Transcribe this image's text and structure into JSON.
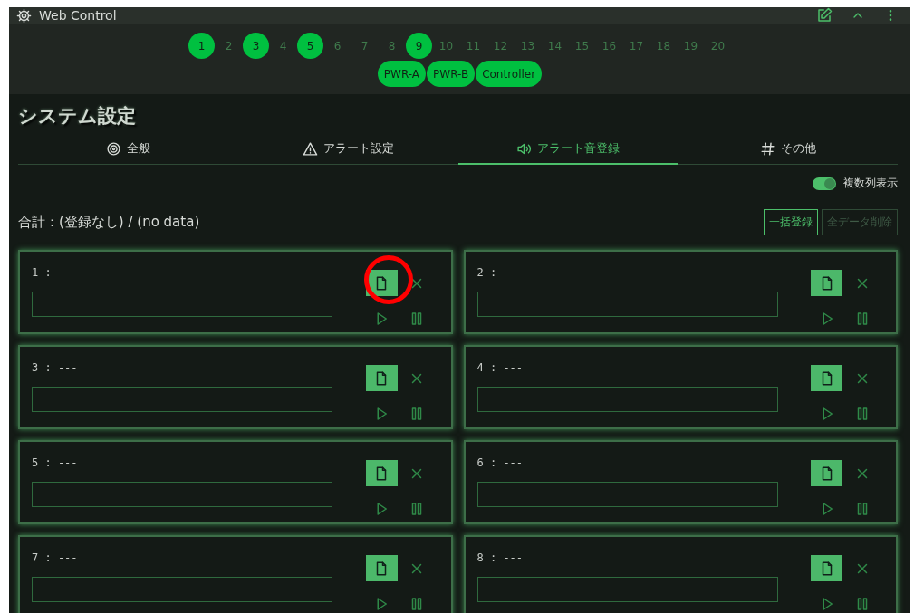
{
  "window": {
    "title": "Web Control"
  },
  "units": [
    {
      "label": "1",
      "selected": true
    },
    {
      "label": "2",
      "selected": false
    },
    {
      "label": "3",
      "selected": true
    },
    {
      "label": "4",
      "selected": false
    },
    {
      "label": "5",
      "selected": true
    },
    {
      "label": "6",
      "selected": false
    },
    {
      "label": "7",
      "selected": false
    },
    {
      "label": "8",
      "selected": false
    },
    {
      "label": "9",
      "selected": true
    },
    {
      "label": "10",
      "selected": false
    },
    {
      "label": "11",
      "selected": false
    },
    {
      "label": "12",
      "selected": false
    },
    {
      "label": "13",
      "selected": false
    },
    {
      "label": "14",
      "selected": false
    },
    {
      "label": "15",
      "selected": false
    },
    {
      "label": "16",
      "selected": false
    },
    {
      "label": "17",
      "selected": false
    },
    {
      "label": "18",
      "selected": false
    },
    {
      "label": "19",
      "selected": false
    },
    {
      "label": "20",
      "selected": false
    }
  ],
  "devices": [
    {
      "label": "PWR-A",
      "selected": true
    },
    {
      "label": "PWR-B",
      "selected": true
    },
    {
      "label": "Controller",
      "selected": true
    }
  ],
  "page_title": "システム設定",
  "tabs": [
    {
      "label": "全般",
      "kind": "target",
      "selected": false
    },
    {
      "label": "アラート設定",
      "kind": "warning",
      "selected": false
    },
    {
      "label": "アラート音登録",
      "kind": "speaker",
      "selected": true
    },
    {
      "label": "その他",
      "kind": "hash",
      "selected": false
    }
  ],
  "multi_column": {
    "label": "複数列表示",
    "on": true
  },
  "summary": "合計：(登録なし) / (no data)",
  "actions": [
    {
      "label": "一括登録",
      "disabled": false
    },
    {
      "label": "全データ削除",
      "disabled": true
    }
  ],
  "slots": [
    {
      "label": "1 : ---",
      "highlighted": true
    },
    {
      "label": "2 : ---",
      "highlighted": false
    },
    {
      "label": "3 : ---",
      "highlighted": false
    },
    {
      "label": "4 : ---",
      "highlighted": false
    },
    {
      "label": "5 : ---",
      "highlighted": false
    },
    {
      "label": "6 : ---",
      "highlighted": false
    },
    {
      "label": "7 : ---",
      "highlighted": false
    },
    {
      "label": "8 : ---",
      "highlighted": false
    }
  ]
}
